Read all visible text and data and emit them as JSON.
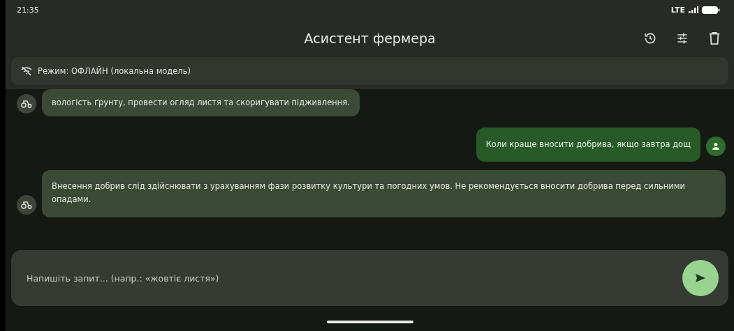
{
  "status_bar": {
    "time": "21:35",
    "network": "LTE"
  },
  "app_bar": {
    "title": "Асистент фермера"
  },
  "mode_banner": {
    "text": "Режим: ОФЛАЙН (локальна модель)"
  },
  "messages": [
    {
      "kind": "bot",
      "text": "вологість ґрунту, провести огляд листя та скоригувати підживлення."
    },
    {
      "kind": "user",
      "text": "Коли краще вносити добрива, якщо завтра дощ"
    },
    {
      "kind": "bot",
      "text": "Внесення добрив слід здійснювати з урахуванням фази розвитку культури та погодних умов. Не рекомендується вносити добрива перед сильними опадами."
    }
  ],
  "composer": {
    "placeholder": "Напишіть запит... (напр.: «жовтіє листя»)"
  }
}
